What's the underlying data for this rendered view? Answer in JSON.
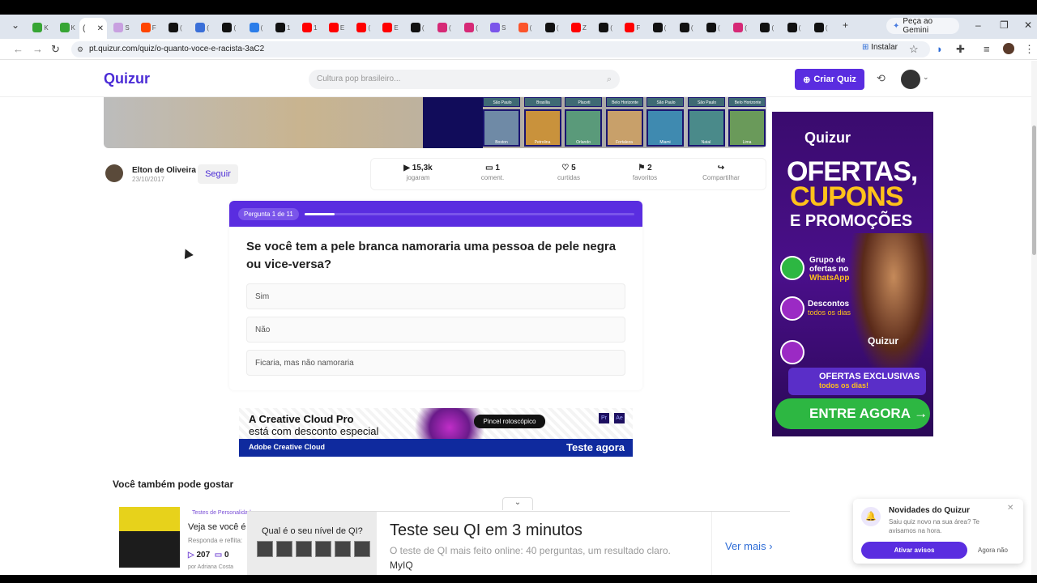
{
  "browser": {
    "tabs": [
      {
        "icon": "K",
        "color": "#37a534",
        "label": "K"
      },
      {
        "icon": "K",
        "color": "#37a534",
        "label": "K"
      },
      {
        "icon": "app",
        "color": "#c8a0e0",
        "label": "S"
      },
      {
        "icon": "reddit",
        "color": "#ff4500",
        "label": "F"
      },
      {
        "icon": "x",
        "color": "#111111",
        "label": "("
      },
      {
        "icon": "mail",
        "color": "#3a6fd8",
        "label": "("
      },
      {
        "icon": "x",
        "color": "#111111",
        "label": "("
      },
      {
        "icon": "app",
        "color": "#2b7de9",
        "label": "("
      },
      {
        "icon": "tiktok",
        "color": "#111111",
        "label": "1"
      },
      {
        "icon": "youtube",
        "color": "#ff0000",
        "label": "1"
      },
      {
        "icon": "youtube",
        "color": "#ff0000",
        "label": "E"
      },
      {
        "icon": "youtube",
        "color": "#ff0000",
        "label": "("
      },
      {
        "icon": "youtube",
        "color": "#ff0000",
        "label": "E"
      },
      {
        "icon": "tiktok",
        "color": "#111111",
        "label": "("
      },
      {
        "icon": "instagram",
        "color": "#d62976",
        "label": "("
      },
      {
        "icon": "instagram",
        "color": "#d62976",
        "label": "("
      },
      {
        "icon": "app",
        "color": "#7a55ea",
        "label": "S"
      },
      {
        "icon": "brave",
        "color": "#fb542b",
        "label": "("
      },
      {
        "icon": "x",
        "color": "#111111",
        "label": "("
      },
      {
        "icon": "youtube",
        "color": "#ff0000",
        "label": "Z"
      },
      {
        "icon": "x",
        "color": "#111111",
        "label": "("
      },
      {
        "icon": "youtube",
        "color": "#ff0000",
        "label": "F"
      },
      {
        "icon": "x",
        "color": "#111111",
        "label": "("
      },
      {
        "icon": "tiktok",
        "color": "#111111",
        "label": "("
      },
      {
        "icon": "x",
        "color": "#111111",
        "label": "("
      },
      {
        "icon": "instagram",
        "color": "#d62976",
        "label": "("
      },
      {
        "icon": "x",
        "color": "#111111",
        "label": "("
      },
      {
        "icon": "x",
        "color": "#111111",
        "label": "("
      },
      {
        "icon": "x",
        "color": "#111111",
        "label": "("
      }
    ],
    "active_tab_label": "(",
    "new_tab": "+",
    "gemini_label": "Peça ao Gemini",
    "url": "pt.quizur.com/quiz/o-quanto-voce-e-racista-3aC2",
    "install_label": "Instalar"
  },
  "header": {
    "logo": "Quizur",
    "search_placeholder": "Cultura pop brasileiro...",
    "create_label": "Criar Quiz"
  },
  "banner": {
    "city_labels_top": [
      "São Paulo",
      "Brasília",
      "Placeti",
      "Belo Horizonte",
      "São Paulo",
      "São Paulo",
      "Belo Horizonte"
    ],
    "city_labels_bottom": [
      "Boston",
      "Petrolina",
      "Orlando",
      "Fortaleza",
      "Miami",
      "Natal",
      "Lima"
    ]
  },
  "author": {
    "name": "Elton de Oliveira",
    "date": "23/10/2017",
    "follow_label": "Seguir"
  },
  "stats": [
    {
      "icon": "play-icon",
      "value": "15,3k",
      "label": "jogaram"
    },
    {
      "icon": "comment-icon",
      "value": "1",
      "label": "coment."
    },
    {
      "icon": "heart-icon",
      "value": "5",
      "label": "curtidas"
    },
    {
      "icon": "bookmark-icon",
      "value": "2",
      "label": "favoritos"
    },
    {
      "icon": "share-icon",
      "value": "",
      "label": "Compartilhar"
    }
  ],
  "question": {
    "counter": "Pergunta 1 de 11",
    "progress": 0.09,
    "text": "Se você tem a pele branca namoraria uma pessoa de pele negra ou vice-versa?",
    "answers": [
      "Sim",
      "Não",
      "Ficaria, mas não namoraria"
    ]
  },
  "adobe_ad": {
    "line1": "A Creative Cloud Pro",
    "line2": "está com desconto especial",
    "brand": "Adobe Creative Cloud",
    "cta": "Teste agora",
    "tooltip": "Pincel rotoscópico"
  },
  "also_like": {
    "title": "Você também pode gostar",
    "card": {
      "category": "Testes de Personalidade",
      "title": "Veja se você é c",
      "subtitle": "Responda e reflita:",
      "plays": "207",
      "comments": "0",
      "author": "por  Adriana Costa"
    }
  },
  "side_ad": {
    "logo": "Quizur",
    "h1": "OFERTAS,",
    "h2": "CUPONS",
    "h3": "E PROMOÇÕES",
    "wa_line1": "Grupo de",
    "wa_line2": "ofertas no",
    "wa_line3": "WhatsApp",
    "disc_line1": "Descontos",
    "disc_line2": "todos os dias",
    "logo2": "Quizur",
    "offers_line1": "OFERTAS EXCLUSIVAS",
    "offers_line2": "todos os dias!",
    "cta": "ENTRE AGORA →"
  },
  "qi_ad": {
    "left_title": "Qual é o seu nível de QI?",
    "title": "Teste seu QI em 3 minutos",
    "subtitle": "O teste de QI mais feito online: 40 perguntas, um resultado claro.",
    "brand": "MyIQ",
    "more": "Ver mais"
  },
  "notification": {
    "title": "Novidades do Quizur",
    "body": "Saiu quiz novo na sua área? Te avisamos na hora.",
    "accept": "Ativar avisos",
    "decline": "Agora não"
  }
}
